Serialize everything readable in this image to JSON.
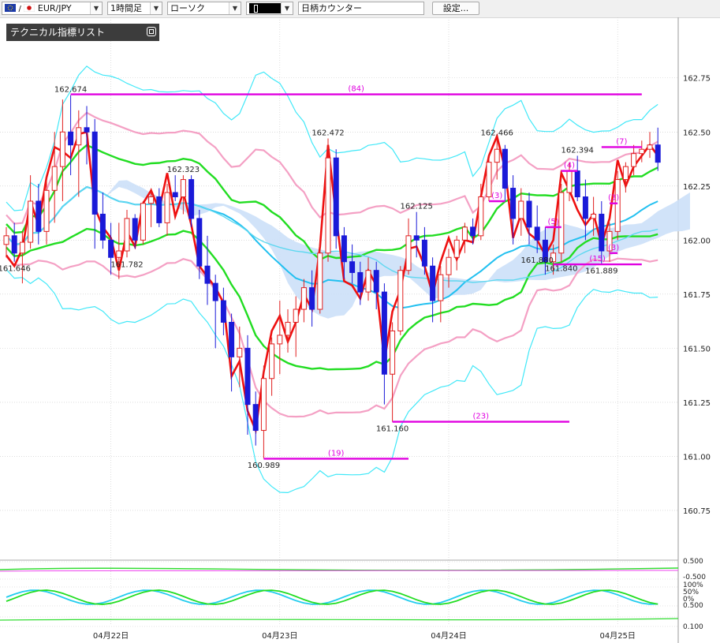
{
  "toolbar": {
    "pair": "EUR/JPY",
    "timeframe": "1時間足",
    "chart_style": "ローソク",
    "color_label": "",
    "counter": "日柄カウンター",
    "settings": "設定..."
  },
  "panel": {
    "title": "テクニカル指標リスト"
  },
  "colors": {
    "bull": "#e02020",
    "bear": "#1a1ad8",
    "magenta": "#e000e0",
    "ichimoku": "#cce0f8",
    "ichimoku_neg": "#f8cfe0"
  },
  "chart_data": {
    "type": "candlestick",
    "yticks": [
      162.75,
      162.5,
      162.25,
      162.0,
      161.75,
      161.5,
      161.25,
      161.0,
      160.75
    ],
    "ytick_labels": [
      "162.75",
      "162.50",
      "162.25",
      "162.00",
      "161.75",
      "161.50",
      "161.25",
      "161.00",
      "160.75"
    ],
    "ylim": [
      160.52,
      163.03
    ],
    "date_labels": [
      "04月22日",
      "04月23日",
      "04月24日",
      "04月25日"
    ],
    "ohlc": [
      [
        161.98,
        162.06,
        161.92,
        162.02
      ],
      [
        162.02,
        162.08,
        161.9,
        161.94
      ],
      [
        161.94,
        162.04,
        161.8,
        161.99
      ],
      [
        161.99,
        162.3,
        161.96,
        162.18
      ],
      [
        162.18,
        162.26,
        161.98,
        162.04
      ],
      [
        162.04,
        162.3,
        161.98,
        162.23
      ],
      [
        162.23,
        162.5,
        162.08,
        162.34
      ],
      [
        162.34,
        162.65,
        162.18,
        162.5
      ],
      [
        162.5,
        162.67,
        162.3,
        162.44
      ],
      [
        162.44,
        162.6,
        162.2,
        162.52
      ],
      [
        162.52,
        162.62,
        162.35,
        162.5
      ],
      [
        162.5,
        162.56,
        161.96,
        162.12
      ],
      [
        162.12,
        162.22,
        161.96,
        162.0
      ],
      [
        162.0,
        162.08,
        161.84,
        161.92
      ],
      [
        161.92,
        162.08,
        161.82,
        161.95
      ],
      [
        161.95,
        162.14,
        161.92,
        162.1
      ],
      [
        162.1,
        162.12,
        161.96,
        162.0
      ],
      [
        162.0,
        162.18,
        161.98,
        162.17
      ],
      [
        162.17,
        162.24,
        162.06,
        162.2
      ],
      [
        162.2,
        162.24,
        162.06,
        162.08
      ],
      [
        162.08,
        162.26,
        162.02,
        162.22
      ],
      [
        162.22,
        162.3,
        162.18,
        162.2
      ],
      [
        162.2,
        162.3,
        162.12,
        162.28
      ],
      [
        162.28,
        162.3,
        162.06,
        162.1
      ],
      [
        162.1,
        162.14,
        161.82,
        161.88
      ],
      [
        161.88,
        162.02,
        161.7,
        161.8
      ],
      [
        161.8,
        161.84,
        161.5,
        161.72
      ],
      [
        161.72,
        161.78,
        161.56,
        161.62
      ],
      [
        161.62,
        161.66,
        161.3,
        161.46
      ],
      [
        161.46,
        161.6,
        161.32,
        161.5
      ],
      [
        161.5,
        161.56,
        161.1,
        161.24
      ],
      [
        161.24,
        161.3,
        161.05,
        161.12
      ],
      [
        161.12,
        161.42,
        160.99,
        161.36
      ],
      [
        161.36,
        161.55,
        161.28,
        161.52
      ],
      [
        161.52,
        161.72,
        161.38,
        161.56
      ],
      [
        161.56,
        161.68,
        161.48,
        161.62
      ],
      [
        161.62,
        161.74,
        161.46,
        161.68
      ],
      [
        161.68,
        161.82,
        161.62,
        161.78
      ],
      [
        161.78,
        161.86,
        161.6,
        161.68
      ],
      [
        161.68,
        162.0,
        161.66,
        161.94
      ],
      [
        161.94,
        162.47,
        161.9,
        162.38
      ],
      [
        162.38,
        162.42,
        161.96,
        162.02
      ],
      [
        162.02,
        162.06,
        161.82,
        161.9
      ],
      [
        161.9,
        161.98,
        161.8,
        161.85
      ],
      [
        161.85,
        161.9,
        161.7,
        161.76
      ],
      [
        161.76,
        161.92,
        161.72,
        161.86
      ],
      [
        161.86,
        161.9,
        161.68,
        161.76
      ],
      [
        161.76,
        161.8,
        161.24,
        161.38
      ],
      [
        161.38,
        161.62,
        161.16,
        161.58
      ],
      [
        161.58,
        161.88,
        161.56,
        161.86
      ],
      [
        161.86,
        162.1,
        161.84,
        162.02
      ],
      [
        162.02,
        162.13,
        161.92,
        162.0
      ],
      [
        162.0,
        162.06,
        161.84,
        161.88
      ],
      [
        161.88,
        161.92,
        161.62,
        161.72
      ],
      [
        161.72,
        161.88,
        161.62,
        161.84
      ],
      [
        161.84,
        161.96,
        161.78,
        161.92
      ],
      [
        161.92,
        162.02,
        161.86,
        162.0
      ],
      [
        162.0,
        162.08,
        161.94,
        162.06
      ],
      [
        162.06,
        162.1,
        161.98,
        162.02
      ],
      [
        162.02,
        162.26,
        162.0,
        162.2
      ],
      [
        162.2,
        162.4,
        162.18,
        162.36
      ],
      [
        162.36,
        162.47,
        162.28,
        162.42
      ],
      [
        162.42,
        162.44,
        162.18,
        162.24
      ],
      [
        162.24,
        162.3,
        161.98,
        162.1
      ],
      [
        162.1,
        162.24,
        162.02,
        162.18
      ],
      [
        162.18,
        162.22,
        161.98,
        162.06
      ],
      [
        162.06,
        162.16,
        161.94,
        162.0
      ],
      [
        162.0,
        162.06,
        161.84,
        161.9
      ],
      [
        161.9,
        161.98,
        161.84,
        161.94
      ],
      [
        161.94,
        162.26,
        161.9,
        162.22
      ],
      [
        162.22,
        162.36,
        162.18,
        162.32
      ],
      [
        162.32,
        162.39,
        162.18,
        162.2
      ],
      [
        162.2,
        162.28,
        162.0,
        162.1
      ],
      [
        162.1,
        162.2,
        162.02,
        162.12
      ],
      [
        162.12,
        162.18,
        161.89,
        161.95
      ],
      [
        161.95,
        162.08,
        161.9,
        162.04
      ],
      [
        162.04,
        162.32,
        162.0,
        162.28
      ],
      [
        162.28,
        162.36,
        162.22,
        162.34
      ],
      [
        162.34,
        162.44,
        162.3,
        162.4
      ],
      [
        162.4,
        162.46,
        162.36,
        162.42
      ],
      [
        162.42,
        162.5,
        162.38,
        162.44
      ],
      [
        162.44,
        162.52,
        162.32,
        162.36
      ]
    ],
    "price_labels": [
      {
        "i": 1,
        "pos": "low",
        "text": "161.646"
      },
      {
        "i": 8,
        "pos": "high",
        "text": "162.674"
      },
      {
        "i": 15,
        "pos": "low",
        "text": "161.782"
      },
      {
        "i": 22,
        "pos": "high",
        "text": "162.323"
      },
      {
        "i": 32,
        "pos": "low",
        "text": "160.989"
      },
      {
        "i": 40,
        "pos": "high",
        "text": "162.472"
      },
      {
        "i": 48,
        "pos": "low",
        "text": "161.160"
      },
      {
        "i": 51,
        "pos": "high",
        "text": "162.125"
      },
      {
        "i": 61,
        "pos": "high",
        "text": "162.466"
      },
      {
        "i": 66,
        "pos": "low",
        "text": "161.880"
      },
      {
        "i": 69,
        "pos": "low",
        "text": "161.840"
      },
      {
        "i": 71,
        "pos": "high",
        "text": "162.394"
      },
      {
        "i": 74,
        "pos": "low",
        "text": "161.889"
      }
    ],
    "counters": [
      {
        "text": "(84)",
        "price": 162.674,
        "from": 8,
        "to": 79
      },
      {
        "text": "(19)",
        "price": 160.989,
        "from": 32,
        "to": 50
      },
      {
        "text": "(23)",
        "price": 161.16,
        "from": 48,
        "to": 70
      },
      {
        "text": "(4)",
        "price": 162.32,
        "from": 69,
        "to": 71
      },
      {
        "text": "(3)",
        "price": 162.18,
        "from": 60,
        "to": 62
      },
      {
        "text": "(5)",
        "price": 162.06,
        "from": 67,
        "to": 69
      },
      {
        "text": "(15)",
        "price": 161.888,
        "from": 68,
        "to": 79
      },
      {
        "text": "(7)",
        "price": 162.43,
        "from": 74,
        "to": 79
      },
      {
        "text": "(3)",
        "price": 162.17,
        "from": 75,
        "to": 76
      },
      {
        "text": "(3)",
        "price": 161.94,
        "from": 75,
        "to": 76
      }
    ],
    "sub_labels": [
      "0.500",
      "-0.500",
      "100%",
      "50%",
      "0%",
      "0.500",
      "0.100"
    ]
  }
}
